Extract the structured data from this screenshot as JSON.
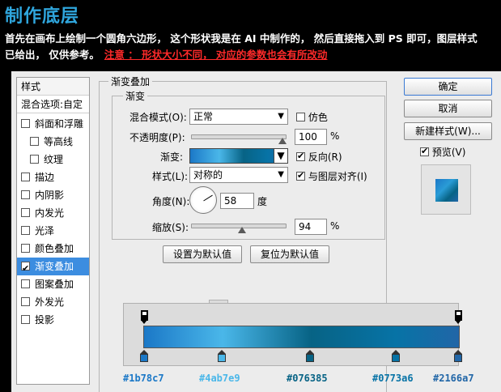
{
  "page": {
    "title": "制作底层",
    "desc_line1": "首先在画布上绘制一个圆角六边形， 这个形状我是在 AI 中制作的， 然后直接拖入到 PS 即可，图层样式",
    "desc_line2": "已给出， 仅供参考。",
    "warning": "注意 ： 形状大小不同， 对应的参数也会有所改动"
  },
  "stylelist": {
    "header": "样式",
    "blend": "混合选项:自定",
    "items": [
      {
        "label": "斜面和浮雕",
        "checked": false
      },
      {
        "label": "等高线",
        "checked": false
      },
      {
        "label": "纹理",
        "checked": false
      },
      {
        "label": "描边",
        "checked": false
      },
      {
        "label": "内阴影",
        "checked": false
      },
      {
        "label": "内发光",
        "checked": false
      },
      {
        "label": "光泽",
        "checked": false
      },
      {
        "label": "颜色叠加",
        "checked": false
      },
      {
        "label": "渐变叠加",
        "checked": true
      },
      {
        "label": "图案叠加",
        "checked": false
      },
      {
        "label": "外发光",
        "checked": false
      },
      {
        "label": "投影",
        "checked": false
      }
    ]
  },
  "panel": {
    "outer_title": "渐变叠加",
    "inner_title": "渐变",
    "blend_mode_label": "混合模式(O):",
    "blend_mode_value": "正常",
    "dither_label": "仿色",
    "dither_checked": false,
    "opacity_label": "不透明度(P):",
    "opacity_value": "100",
    "percent": "%",
    "gradient_label": "渐变:",
    "reverse_label": "反向(R)",
    "reverse_checked": true,
    "style_label": "样式(L):",
    "style_value": "对称的",
    "align_label": "与图层对齐(I)",
    "align_checked": true,
    "angle_label": "角度(N):",
    "angle_value": "58",
    "degree": "度",
    "scale_label": "缩放(S):",
    "scale_value": "94",
    "set_default": "设置为默认值",
    "reset_default": "复位为默认值"
  },
  "buttons": {
    "ok": "确定",
    "cancel": "取消",
    "new_style": "新建样式(W)...",
    "preview_label": "预览(V)",
    "preview_checked": true
  },
  "gradient_stops": [
    {
      "hex": "#1b78c7",
      "color": "#1b78c7",
      "position": 0
    },
    {
      "hex": "#4ab7e9",
      "color": "#4ab7e9",
      "position": 25
    },
    {
      "hex": "#076385",
      "color": "#076385",
      "position": 53
    },
    {
      "hex": "#0773a6",
      "color": "#0773a6",
      "position": 80
    },
    {
      "hex": "#2166a7",
      "color": "#2166a7",
      "position": 100
    }
  ],
  "colors": {
    "title": "#2fa6dd",
    "warning": "#ff2a2a",
    "selection": "#3c8de0"
  }
}
